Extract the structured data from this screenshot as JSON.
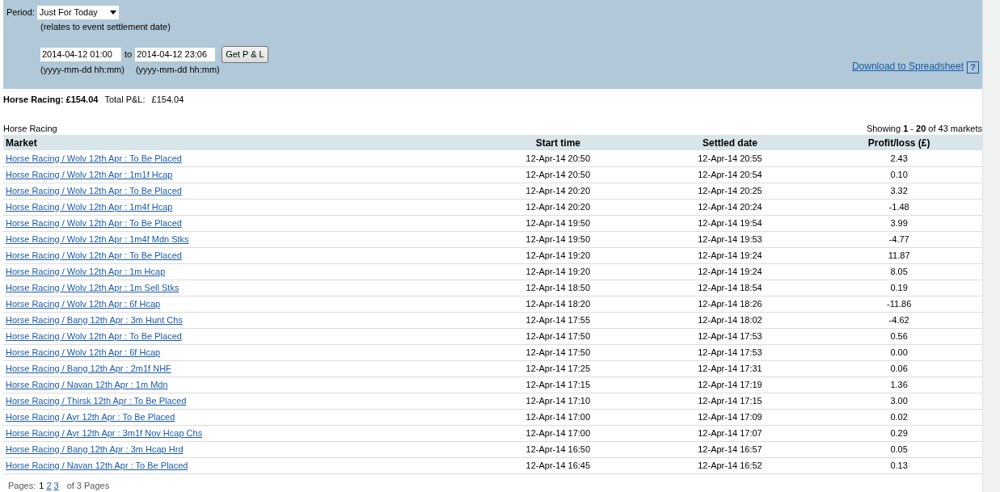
{
  "filter": {
    "period_label": "Period:",
    "period_value": "Just For Today",
    "period_note": "(relates to event settlement date)",
    "from_value": "2014-04-12 01:00",
    "to_label": "to",
    "to_value": "2014-04-12 23:06",
    "button": "Get P & L",
    "from_hint": "(yyyy-mm-dd hh:mm)",
    "to_hint": "(yyyy-mm-dd hh:mm)",
    "download_link": "Download to Spreadsheet",
    "help": "?"
  },
  "summary": {
    "sport_total": "Horse Racing: £154.04",
    "total_label": "Total P&L:",
    "total_value": "£154.04"
  },
  "table": {
    "caption": "Horse Racing",
    "showing": "Showing **1** - **20** of 43 markets",
    "columns": [
      "Market",
      "Start time",
      "Settled date",
      "Profit/loss (£)"
    ],
    "rows": [
      [
        "Horse Racing / Wolv 12th Apr : To Be Placed",
        "12-Apr-14 20:50",
        "12-Apr-14 20:55",
        "2.43"
      ],
      [
        "Horse Racing / Wolv 12th Apr : 1m1f Hcap",
        "12-Apr-14 20:50",
        "12-Apr-14 20:54",
        "0.10"
      ],
      [
        "Horse Racing / Wolv 12th Apr : To Be Placed",
        "12-Apr-14 20:20",
        "12-Apr-14 20:25",
        "3.32"
      ],
      [
        "Horse Racing / Wolv 12th Apr : 1m4f Hcap",
        "12-Apr-14 20:20",
        "12-Apr-14 20:24",
        "-1.48"
      ],
      [
        "Horse Racing / Wolv 12th Apr : To Be Placed",
        "12-Apr-14 19:50",
        "12-Apr-14 19:54",
        "3.99"
      ],
      [
        "Horse Racing / Wolv 12th Apr : 1m4f Mdn Stks",
        "12-Apr-14 19:50",
        "12-Apr-14 19:53",
        "-4.77"
      ],
      [
        "Horse Racing / Wolv 12th Apr : To Be Placed",
        "12-Apr-14 19:20",
        "12-Apr-14 19:24",
        "11.87"
      ],
      [
        "Horse Racing / Wolv 12th Apr : 1m Hcap",
        "12-Apr-14 19:20",
        "12-Apr-14 19:24",
        "8.05"
      ],
      [
        "Horse Racing / Wolv 12th Apr : 1m Sell Stks",
        "12-Apr-14 18:50",
        "12-Apr-14 18:54",
        "0.19"
      ],
      [
        "Horse Racing / Wolv 12th Apr : 6f Hcap",
        "12-Apr-14 18:20",
        "12-Apr-14 18:26",
        "-11.86"
      ],
      [
        "Horse Racing / Bang 12th Apr : 3m Hunt Chs",
        "12-Apr-14 17:55",
        "12-Apr-14 18:02",
        "-4.62"
      ],
      [
        "Horse Racing / Wolv 12th Apr : To Be Placed",
        "12-Apr-14 17:50",
        "12-Apr-14 17:53",
        "0.56"
      ],
      [
        "Horse Racing / Wolv 12th Apr : 6f Hcap",
        "12-Apr-14 17:50",
        "12-Apr-14 17:53",
        "0.00"
      ],
      [
        "Horse Racing / Bang 12th Apr : 2m1f NHF",
        "12-Apr-14 17:25",
        "12-Apr-14 17:31",
        "0.06"
      ],
      [
        "Horse Racing / Navan 12th Apr : 1m Mdn",
        "12-Apr-14 17:15",
        "12-Apr-14 17:19",
        "1.36"
      ],
      [
        "Horse Racing / Thirsk 12th Apr : To Be Placed",
        "12-Apr-14 17:10",
        "12-Apr-14 17:15",
        "3.00"
      ],
      [
        "Horse Racing / Ayr 12th Apr : To Be Placed",
        "12-Apr-14 17:00",
        "12-Apr-14 17:09",
        "0.02"
      ],
      [
        "Horse Racing / Ayr 12th Apr : 3m1f Nov Hcap Chs",
        "12-Apr-14 17:00",
        "12-Apr-14 17:07",
        "0.29"
      ],
      [
        "Horse Racing / Bang 12th Apr : 3m Hcap Hrd",
        "12-Apr-14 16:50",
        "12-Apr-14 16:57",
        "0.05"
      ],
      [
        "Horse Racing / Navan 12th Apr : To Be Placed",
        "12-Apr-14 16:45",
        "12-Apr-14 16:52",
        "0.13"
      ]
    ]
  },
  "pager": {
    "label": "Pages:",
    "pages": [
      {
        "label": "1",
        "selected": true
      },
      {
        "label": "2",
        "selected": false
      },
      {
        "label": "3",
        "selected": false
      }
    ],
    "total": "of 3 Pages"
  }
}
